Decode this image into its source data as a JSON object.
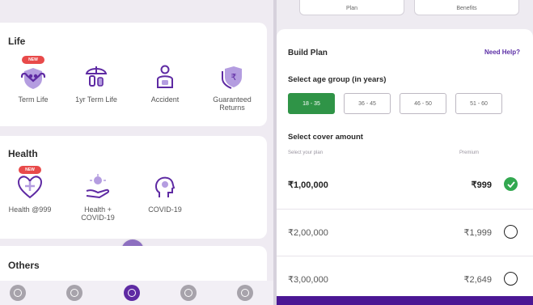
{
  "life": {
    "title": "Life",
    "items": [
      {
        "label": "Term Life",
        "icon": "family-shield-icon",
        "badge": "NEW"
      },
      {
        "label": "1yr Term Life",
        "icon": "umbrella-family-icon"
      },
      {
        "label": "Accident",
        "icon": "accident-person-icon"
      },
      {
        "label": "Guaranteed Returns",
        "icon": "rupee-shield-icon"
      }
    ]
  },
  "health": {
    "title": "Health",
    "items": [
      {
        "label": "Health @999",
        "icon": "heart-icon",
        "badge": "NEW"
      },
      {
        "label": "Health + COVID-19",
        "icon": "hand-virus-icon"
      },
      {
        "label": "COVID-19",
        "icon": "head-virus-icon"
      }
    ]
  },
  "others": {
    "title": "Others"
  },
  "bottom_nav": [
    "home-icon",
    "shield-nav-icon",
    "insurance-icon",
    "rupee-icon",
    "chat-icon"
  ],
  "top_buttons": [
    "Plan",
    "Benefits"
  ],
  "build_plan": {
    "title": "Build Plan",
    "help": "Need Help?",
    "age_label": "Select age group (in years)",
    "age_groups": [
      "18 - 35",
      "36 - 45",
      "46 - 50",
      "51 - 60"
    ],
    "selected_age": 0,
    "cover_label": "Select cover amount",
    "col_left": "Select your plan",
    "col_right": "Premium",
    "options": [
      {
        "amount": "₹1,00,000",
        "premium": "₹999",
        "selected": true
      },
      {
        "amount": "₹2,00,000",
        "premium": "₹1,999",
        "selected": false
      },
      {
        "amount": "₹3,00,000",
        "premium": "₹2,649",
        "selected": false
      }
    ]
  },
  "colors": {
    "primary": "#5e2aa3",
    "accent_green": "#2f9447",
    "badge_red": "#e84a4a"
  }
}
